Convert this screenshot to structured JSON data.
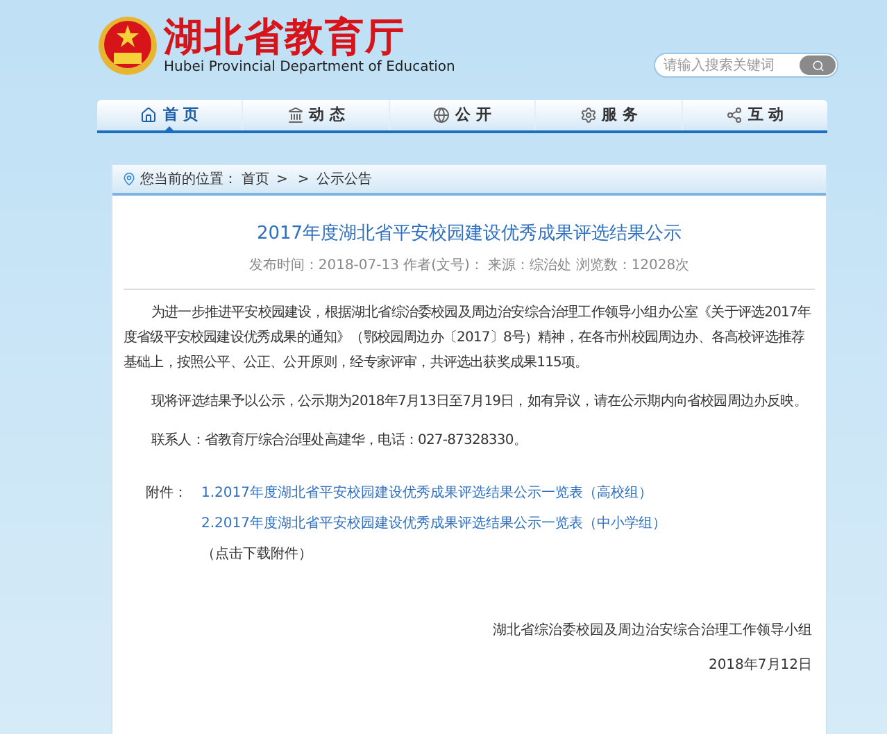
{
  "header": {
    "title": "湖北省教育厅",
    "subtitle": "Hubei Provincial Department of Education"
  },
  "search": {
    "placeholder": "请输入搜索关键词"
  },
  "nav": [
    {
      "label": "首 页",
      "selected": true
    },
    {
      "label": "动 态",
      "selected": false
    },
    {
      "label": "公 开",
      "selected": false
    },
    {
      "label": "服 务",
      "selected": false
    },
    {
      "label": "互 动",
      "selected": false
    }
  ],
  "breadcrumb": {
    "prefix": "您当前的位置：",
    "path": [
      {
        "text": "首页",
        "kind": "link"
      },
      {
        "text": ">",
        "kind": "separator"
      },
      {
        "text": ">",
        "kind": "separator"
      },
      {
        "text": "公示公告",
        "kind": "link"
      }
    ]
  },
  "article": {
    "title": "2017年度湖北省平安校园建设优秀成果评选结果公示",
    "meta": "发布时间：2018-07-13 作者(文号)： 来源：综治处 浏览数：12028次",
    "paragraphs": [
      "为进一步推进平安校园建设，根据湖北省综治委校园及周边治安综合治理工作领导小组办公室《关于评选2017年度省级平安校园建设优秀成果的通知》（鄂校园周边办〔2017〕8号）精神，在各市州校园周边办、各高校评选推荐基础上，按照公平、公正、公开原则，经专家评审，共评选出获奖成果115项。",
      "现将评选结果予以公示，公示期为2018年7月13日至7月19日，如有异议，请在公示期内向省校园周边办反映。",
      "联系人：省教育厅综合治理处高建华，电话：027-87328330。"
    ],
    "attachments": {
      "label": "附件：",
      "links": [
        "1.2017年度湖北省平安校园建设优秀成果评选结果公示一览表（高校组）",
        "2.2017年度湖北省平安校园建设优秀成果评选结果公示一览表（中小学组）"
      ],
      "note": "（点击下载附件）"
    },
    "signature": {
      "org": "湖北省综治委校园及周边治安综合治理工作领导小组",
      "date": "2018年7月12日"
    }
  }
}
